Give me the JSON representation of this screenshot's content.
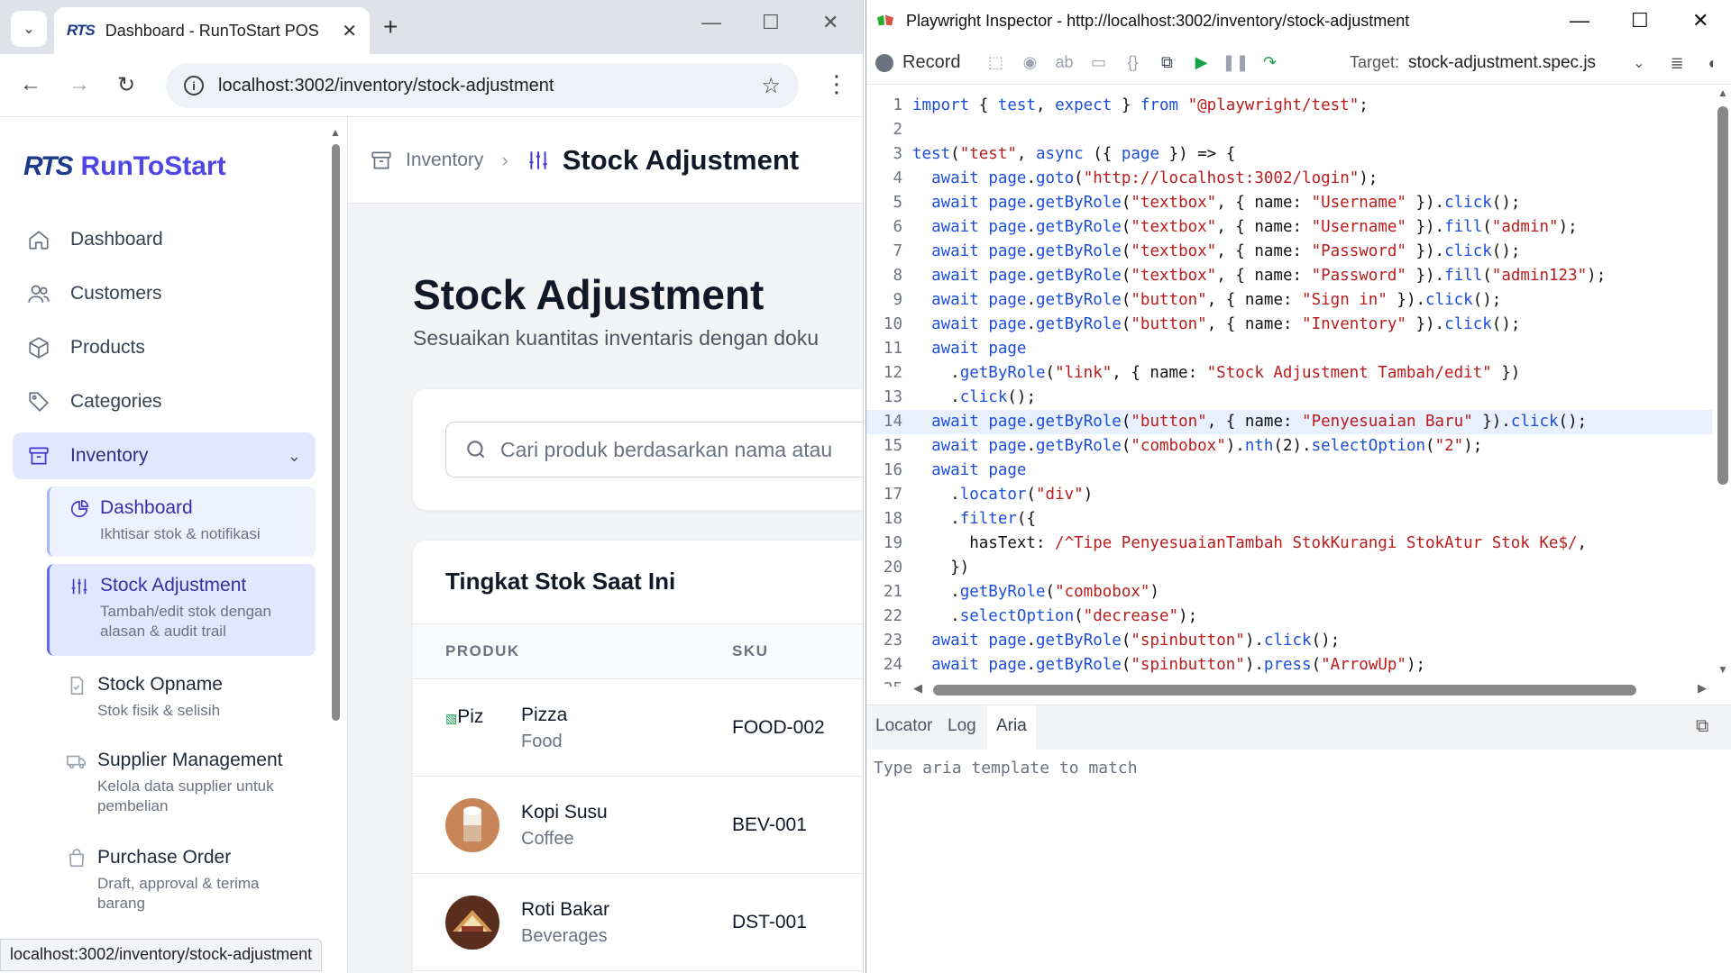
{
  "browser": {
    "tab_title": "Dashboard - RunToStart POS",
    "favicon_text": "RTS",
    "url": "localhost:3002/inventory/stock-adjustment",
    "status_url": "localhost:3002/inventory/stock-adjustment"
  },
  "app": {
    "logo_mark": "RTS",
    "brand": "RunToStart",
    "nav": [
      {
        "label": "Dashboard",
        "icon": "home-icon"
      },
      {
        "label": "Customers",
        "icon": "users-icon"
      },
      {
        "label": "Products",
        "icon": "box-icon"
      },
      {
        "label": "Categories",
        "icon": "tag-icon"
      },
      {
        "label": "Inventory",
        "icon": "archive-icon"
      }
    ],
    "inventory_sub": [
      {
        "title": "Dashboard",
        "desc": "Ikhtisar stok & notifikasi"
      },
      {
        "title": "Stock Adjustment",
        "desc": "Tambah/edit stok dengan alasan & audit trail"
      },
      {
        "title": "Stock Opname",
        "desc": "Stok fisik & selisih"
      },
      {
        "title": "Supplier Management",
        "desc": "Kelola data supplier untuk pembelian"
      },
      {
        "title": "Purchase Order",
        "desc": "Draft, approval & terima barang"
      }
    ],
    "breadcrumb": {
      "parent": "Inventory",
      "current": "Stock Adjustment"
    },
    "page_title": "Stock Adjustment",
    "page_subtitle": "Sesuaikan kuantitas inventaris dengan doku",
    "search_placeholder": "Cari produk berdasarkan nama atau",
    "table": {
      "title": "Tingkat Stok Saat Ini",
      "columns": [
        "PRODUK",
        "SKU"
      ],
      "rows": [
        {
          "name": "Pizza",
          "category": "Food",
          "sku": "FOOD-002",
          "img_alt": "Piz"
        },
        {
          "name": "Kopi Susu",
          "category": "Coffee",
          "sku": "BEV-001"
        },
        {
          "name": "Roti Bakar",
          "category": "Beverages",
          "sku": "DST-001"
        }
      ]
    }
  },
  "inspector": {
    "title": "Playwright Inspector - http://localhost:3002/inventory/stock-adjustment",
    "record_label": "Record",
    "target_label": "Target:",
    "target_value": "stock-adjustment.spec.js",
    "tabs": [
      "Locator",
      "Log",
      "Aria"
    ],
    "active_tab": "Aria",
    "aria_placeholder": "Type aria template to match",
    "current_line": 14,
    "code_lines": [
      "import { test, expect } from \"@playwright/test\";",
      "",
      "test(\"test\", async ({ page }) => {",
      "  await page.goto(\"http://localhost:3002/login\");",
      "  await page.getByRole(\"textbox\", { name: \"Username\" }).click();",
      "  await page.getByRole(\"textbox\", { name: \"Username\" }).fill(\"admin\");",
      "  await page.getByRole(\"textbox\", { name: \"Password\" }).click();",
      "  await page.getByRole(\"textbox\", { name: \"Password\" }).fill(\"admin123\");",
      "  await page.getByRole(\"button\", { name: \"Sign in\" }).click();",
      "  await page.getByRole(\"button\", { name: \"Inventory\" }).click();",
      "  await page",
      "    .getByRole(\"link\", { name: \"Stock Adjustment Tambah/edit\" })",
      "    .click();",
      "  await page.getByRole(\"button\", { name: \"Penyesuaian Baru\" }).click();",
      "  await page.getByRole(\"combobox\").nth(2).selectOption(\"2\");",
      "  await page",
      "    .locator(\"div\")",
      "    .filter({",
      "      hasText: /^Tipe PenyesuaianTambah StokKurangi StokAtur Stok Ke$/,",
      "    })",
      "    .getByRole(\"combobox\")",
      "    .selectOption(\"decrease\");",
      "  await page.getByRole(\"spinbutton\").click();",
      "  await page.getByRole(\"spinbutton\").press(\"ArrowUp\");",
      ""
    ]
  }
}
